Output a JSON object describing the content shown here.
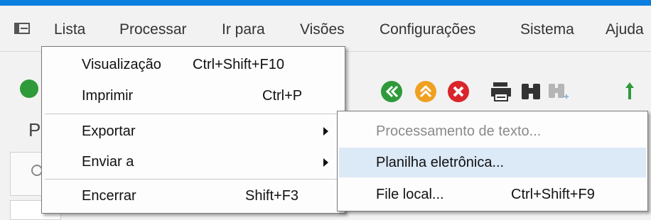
{
  "menubar": {
    "items": [
      {
        "label": "Lista"
      },
      {
        "label": "Processar"
      },
      {
        "label": "Ir para"
      },
      {
        "label": "Visões"
      },
      {
        "label": "Configurações"
      },
      {
        "label": "Sistema"
      },
      {
        "label": "Ajuda"
      }
    ]
  },
  "lista_menu": {
    "items": [
      {
        "label": "Visualização",
        "shortcut": "Ctrl+Shift+F10"
      },
      {
        "label": "Imprimir",
        "shortcut": "Ctrl+P"
      },
      {
        "label": "Exportar",
        "shortcut": ""
      },
      {
        "label": "Enviar a",
        "shortcut": ""
      },
      {
        "label": "Encerrar",
        "shortcut": "Shift+F3"
      }
    ]
  },
  "exportar_submenu": {
    "items": [
      {
        "label": "Processamento de texto...",
        "shortcut": "",
        "disabled": true
      },
      {
        "label": "Planilha eletrônica...",
        "shortcut": "",
        "highlighted": true
      },
      {
        "label": "File local...",
        "shortcut": "Ctrl+Shift+F9"
      }
    ]
  },
  "background": {
    "peek_title_letter": "P"
  },
  "colors": {
    "accent": "#0a7fe0",
    "highlight": "#dce9f7",
    "back": "#2f9a3a",
    "exit": "#f0a020",
    "cancel": "#d9252b"
  },
  "toolbar": {
    "icons": [
      "back-icon",
      "exit-icon",
      "cancel-icon",
      "print-icon",
      "find-icon",
      "find-next-icon",
      "sort-icon"
    ]
  }
}
